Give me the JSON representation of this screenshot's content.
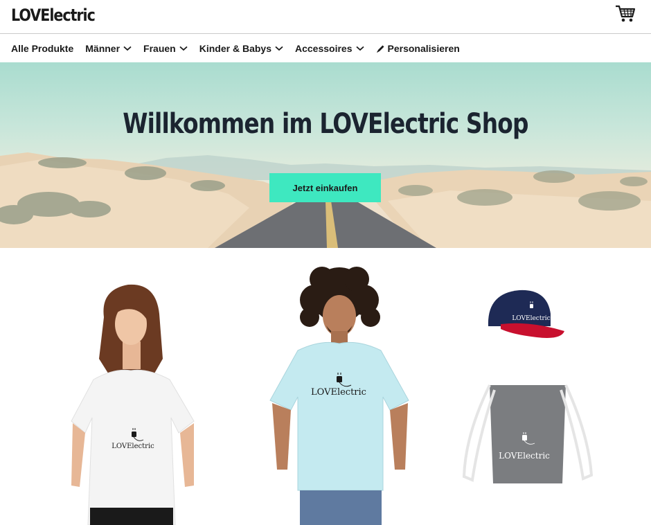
{
  "header": {
    "logo": "LOVElectric",
    "cart_icon": "shopping-cart-icon"
  },
  "nav": {
    "items": [
      {
        "label": "Alle Produkte",
        "has_dropdown": false
      },
      {
        "label": "Männer",
        "has_dropdown": true
      },
      {
        "label": "Frauen",
        "has_dropdown": true
      },
      {
        "label": "Kinder & Babys",
        "has_dropdown": true
      },
      {
        "label": "Accessoires",
        "has_dropdown": true
      },
      {
        "label": "Personalisieren",
        "icon": "pencil-icon"
      }
    ]
  },
  "hero": {
    "title": "Willkommen im LOVElectric Shop",
    "cta_label": "Jetzt einkaufen"
  },
  "products": {
    "brand_print": "LOVElectric",
    "items": [
      {
        "name": "women-tshirt",
        "shirt_color": "#f4f4f4"
      },
      {
        "name": "men-tshirt",
        "shirt_color": "#c4eaf0"
      },
      {
        "name": "cap",
        "crown_color": "#1e2a55",
        "brim_color": "#c8102e"
      },
      {
        "name": "gym-bag",
        "bag_color": "#7b7d80"
      }
    ]
  },
  "colors": {
    "accent": "#3ee8c0",
    "text": "#1a1a1a",
    "hero_title": "#1b2430"
  }
}
